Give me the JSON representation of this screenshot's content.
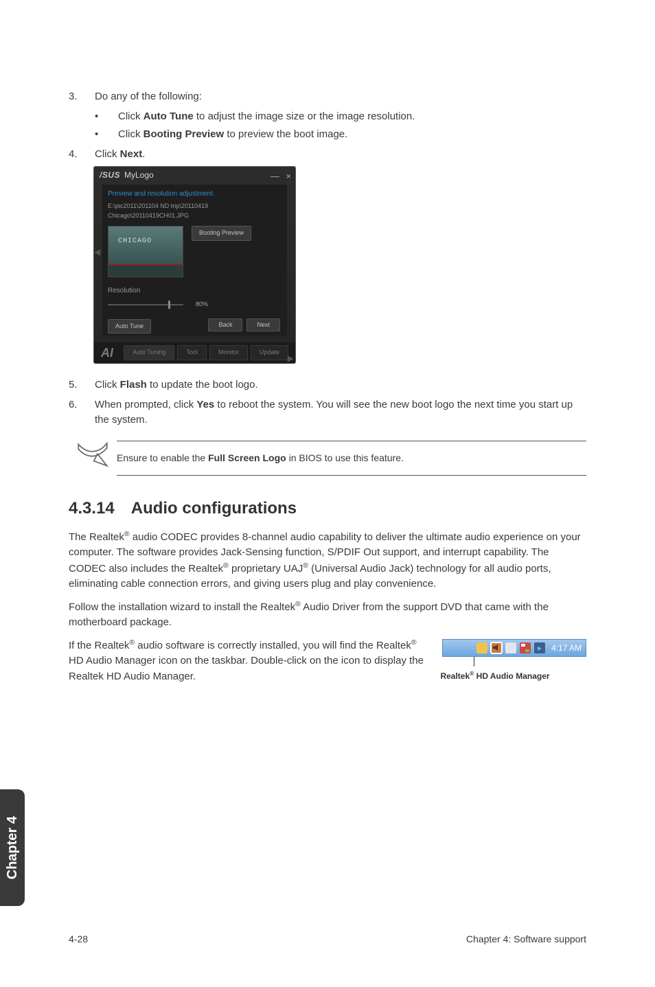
{
  "steps": {
    "s3": {
      "num": "3.",
      "text": "Do any of the following:"
    },
    "s3a": {
      "prefix": "Click ",
      "bold": "Auto Tune",
      "suffix": " to adjust the image size or the image resolution."
    },
    "s3b": {
      "prefix": "Click ",
      "bold": "Booting Preview",
      "suffix": " to preview the boot image."
    },
    "s4": {
      "num": "4.",
      "prefix": "Click ",
      "bold": "Next",
      "suffix": "."
    },
    "s5": {
      "num": "5.",
      "prefix": "Click ",
      "bold": "Flash",
      "suffix": " to update the boot logo."
    },
    "s6": {
      "num": "6.",
      "prefix": "When prompted, click ",
      "bold": "Yes",
      "suffix": " to reboot the system. You will see the new boot logo the next time you start up the system."
    }
  },
  "screenshot": {
    "brand": "/SUS",
    "title": "MyLogo",
    "win_min": "—",
    "win_close": "×",
    "panel_heading": "Preview and resolution adjustment.",
    "path": "E:\\pic2011\\201104 ND trip\\20110419 Chicago\\20110419CH01.JPG",
    "thumb_watermark": "CHICAGO",
    "btn_preview": "Booting Preview",
    "res_label": "Resolution",
    "pct": "80%",
    "btn_auto": "Auto Tune",
    "btn_back": "Back",
    "btn_next": "Next",
    "brand_footer": "AI",
    "tabs": [
      "Auto Tuning",
      "Tool",
      "Monitor",
      "Update"
    ]
  },
  "note": {
    "prefix": "Ensure to enable the ",
    "bold": "Full Screen Logo",
    "suffix": " in BIOS to use this feature."
  },
  "heading": {
    "num": "4.3.14",
    "title": "Audio configurations"
  },
  "para1": {
    "a": "The Realtek",
    "b": " audio CODEC provides 8-channel audio capability to deliver the ultimate audio experience on your computer. The software provides Jack-Sensing function, S/PDIF Out support, and interrupt capability. The CODEC also includes the Realtek",
    "c": " proprietary UAJ",
    "d": " (Universal Audio Jack) technology for all audio ports, eliminating cable connection errors, and giving users plug and play convenience."
  },
  "para2": {
    "a": "Follow the installation wizard to install the Realtek",
    "b": " Audio Driver from the support DVD that came with the motherboard package."
  },
  "para3": {
    "a": "If the Realtek",
    "b": " audio software is correctly installed, you will find the Realtek",
    "c": " HD Audio Manager icon on the taskbar. Double-click on the icon to display the Realtek HD Audio Manager."
  },
  "reg": "®",
  "tray": {
    "time": "4:17 AM",
    "caption_a": "Realtek",
    "caption_b": " HD Audio Manager"
  },
  "sidetab": "Chapter 4",
  "footer": {
    "left": "4-28",
    "right": "Chapter 4: Software support"
  }
}
